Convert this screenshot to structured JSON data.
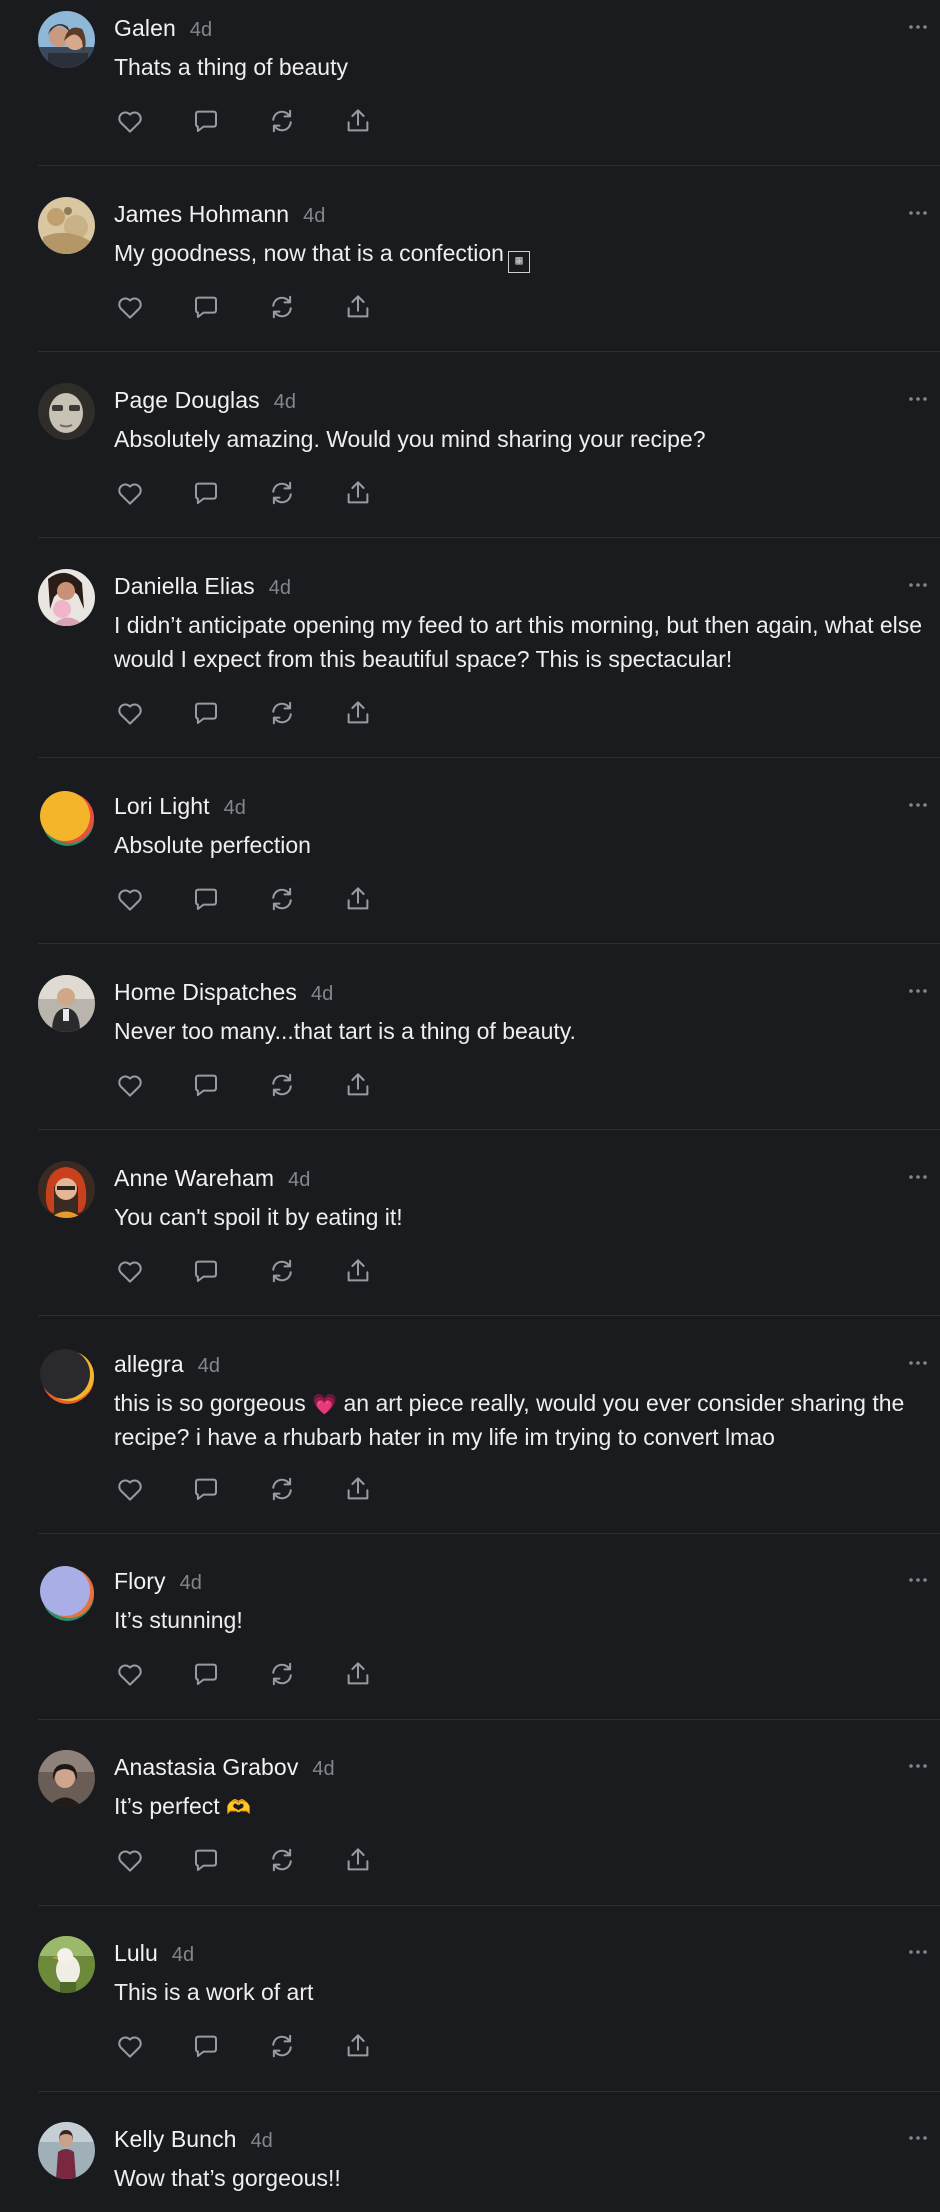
{
  "colors": {
    "background": "#1a1b1e",
    "divider": "#2e2f33",
    "icon": "#9a9ba0",
    "timestamp": "#85868b"
  },
  "action_icons": [
    "heart-icon",
    "reply-icon",
    "restack-icon",
    "share-icon"
  ],
  "comments": [
    {
      "author": "Galen",
      "time": "4d",
      "text": "Thats a thing of beauty",
      "avatar": "photo-couple"
    },
    {
      "author": "James Hohmann",
      "time": "4d",
      "text": "My goodness, now that is a confection",
      "text_suffix_icon": "unicode-box-icon",
      "avatar": "photo-beige"
    },
    {
      "author": "Page Douglas",
      "time": "4d",
      "text": "Absolutely amazing. Would you mind sharing your recipe?",
      "avatar": "photo-face"
    },
    {
      "author": "Daniella Elias",
      "time": "4d",
      "text": "I didn’t anticipate opening my feed to art this morning, but then again, what else would I expect from this beautiful space? This is spectacular!",
      "avatar": "photo-woman-baby"
    },
    {
      "author": "Lori Light",
      "time": "4d",
      "text": "Absolute perfection",
      "avatar": "default-orange"
    },
    {
      "author": "Home Dispatches",
      "time": "4d",
      "text": "Never too many...that tart is a thing of beauty.",
      "avatar": "photo-man"
    },
    {
      "author": "Anne Wareham",
      "time": "4d",
      "text": "You can't spoil it by eating it!",
      "avatar": "photo-redhair"
    },
    {
      "author": "allegra",
      "time": "4d",
      "text_before_emoji": "this is so gorgeous",
      "emoji": "💗",
      "text_after_emoji": "an art piece really, would you ever consider sharing the recipe? i have a rhubarb hater in my life im trying to convert lmao",
      "avatar": "default-dark"
    },
    {
      "author": "Flory",
      "time": "4d",
      "text": "It’s stunning!",
      "avatar": "default-lavender"
    },
    {
      "author": "Anastasia Grabov",
      "time": "4d",
      "text": "It’s perfect",
      "emoji": "🫶",
      "avatar": "photo-dark"
    },
    {
      "author": "Lulu",
      "time": "4d",
      "text": "This is a work of art",
      "avatar": "photo-bird"
    },
    {
      "author": "Kelly Bunch",
      "time": "4d",
      "text": "Wow that’s gorgeous!!",
      "avatar": "photo-woman"
    }
  ]
}
